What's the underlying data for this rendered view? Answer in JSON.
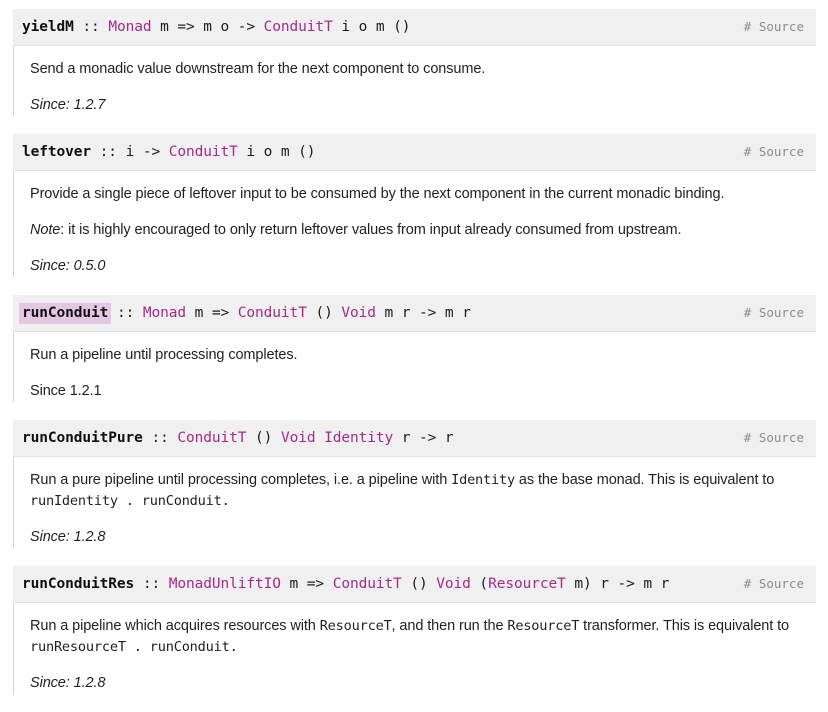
{
  "page": {
    "source_link_label": "# Source",
    "accent_type_color": "#a52a8c",
    "highlight_color": "#e3c7e3",
    "sig_bar_color": "#f0f0f0"
  },
  "entities": [
    {
      "name": "yieldM",
      "highlighted": false,
      "signature_parts": [
        {
          "kind": "name",
          "text": "yieldM"
        },
        {
          "kind": "plain",
          "text": " :: "
        },
        {
          "kind": "tycon",
          "text": "Monad"
        },
        {
          "kind": "plain",
          "text": " m => m o -> "
        },
        {
          "kind": "tycon",
          "text": "ConduitT"
        },
        {
          "kind": "plain",
          "text": " i o m ()"
        }
      ],
      "description": "Send a monadic value downstream for the next component to consume.",
      "note": "",
      "code_line": "",
      "since": "Since: 1.2.7",
      "since_italic": true
    },
    {
      "name": "leftover",
      "highlighted": false,
      "signature_parts": [
        {
          "kind": "name",
          "text": "leftover"
        },
        {
          "kind": "plain",
          "text": " :: i -> "
        },
        {
          "kind": "tycon",
          "text": "ConduitT"
        },
        {
          "kind": "plain",
          "text": " i o m ()"
        }
      ],
      "description": "Provide a single piece of leftover input to be consumed by the next component in the current monadic binding.",
      "note_label": "Note",
      "note": ": it is highly encouraged to only return leftover values from input already consumed from upstream.",
      "code_line": "",
      "since": "Since: 0.5.0",
      "since_italic": true
    },
    {
      "name": "runConduit",
      "highlighted": true,
      "signature_parts": [
        {
          "kind": "name",
          "text": "runConduit"
        },
        {
          "kind": "plain",
          "text": " :: "
        },
        {
          "kind": "tycon",
          "text": "Monad"
        },
        {
          "kind": "plain",
          "text": " m => "
        },
        {
          "kind": "tycon",
          "text": "ConduitT"
        },
        {
          "kind": "plain",
          "text": " () "
        },
        {
          "kind": "tycon",
          "text": "Void"
        },
        {
          "kind": "plain",
          "text": " m r -> m r"
        }
      ],
      "description": "Run a pipeline until processing completes.",
      "note": "",
      "code_line": "",
      "since": "Since 1.2.1",
      "since_italic": false
    },
    {
      "name": "runConduitPure",
      "highlighted": false,
      "signature_parts": [
        {
          "kind": "name",
          "text": "runConduitPure"
        },
        {
          "kind": "plain",
          "text": " :: "
        },
        {
          "kind": "tycon",
          "text": "ConduitT"
        },
        {
          "kind": "plain",
          "text": " () "
        },
        {
          "kind": "tycon",
          "text": "Void"
        },
        {
          "kind": "plain",
          "text": " "
        },
        {
          "kind": "tycon",
          "text": "Identity"
        },
        {
          "kind": "plain",
          "text": " r -> r"
        }
      ],
      "description_pre": "Run a pure pipeline until processing completes, i.e. a pipeline with ",
      "description_code": "Identity",
      "description_post": " as the base monad. This is equivalent to",
      "code_line": "runIdentity . runConduit.",
      "note": "",
      "since": "Since: 1.2.8",
      "since_italic": true
    },
    {
      "name": "runConduitRes",
      "highlighted": false,
      "signature_parts": [
        {
          "kind": "name",
          "text": "runConduitRes"
        },
        {
          "kind": "plain",
          "text": " :: "
        },
        {
          "kind": "tycon",
          "text": "MonadUnliftIO"
        },
        {
          "kind": "plain",
          "text": " m => "
        },
        {
          "kind": "tycon",
          "text": "ConduitT"
        },
        {
          "kind": "plain",
          "text": " () "
        },
        {
          "kind": "tycon",
          "text": "Void"
        },
        {
          "kind": "plain",
          "text": " ("
        },
        {
          "kind": "tycon",
          "text": "ResourceT"
        },
        {
          "kind": "plain",
          "text": " m) r -> m r"
        }
      ],
      "description_pre": "Run a pipeline which acquires resources with ",
      "description_code": "ResourceT",
      "description_mid": ", and then run the ",
      "description_code2": "ResourceT",
      "description_post": " transformer. This is equivalent to",
      "code_line": "runResourceT . runConduit.",
      "note": "",
      "since": "Since: 1.2.8",
      "since_italic": true
    }
  ]
}
